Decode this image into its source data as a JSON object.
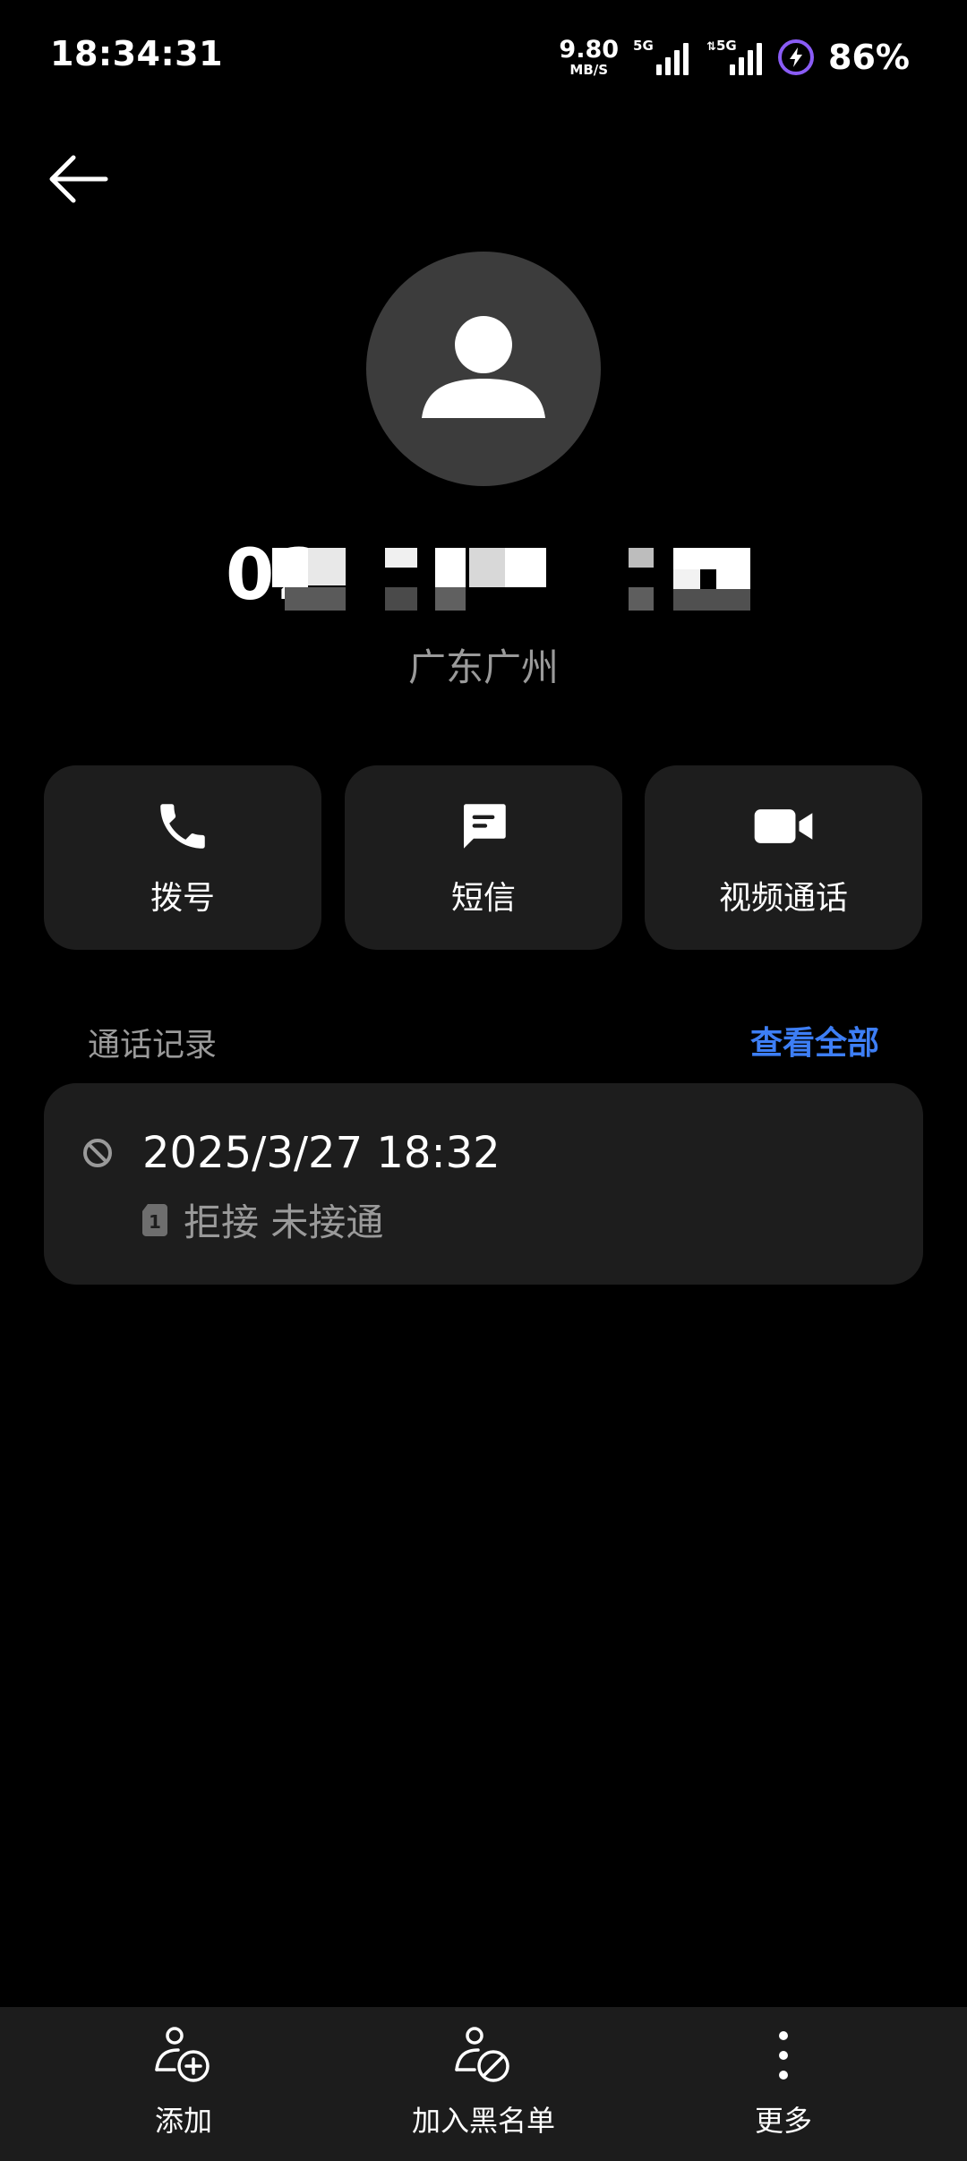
{
  "status_bar": {
    "time": "18:34:31",
    "net_speed_value": "9.80",
    "net_speed_unit": "MB/S",
    "sim1_tag": "5G",
    "sim2_tag": "5G",
    "battery_percent": "86%",
    "battery_icon": "charging-bolt-icon"
  },
  "header": {
    "back_icon": "arrow-left-icon"
  },
  "contact": {
    "avatar_icon": "person-icon",
    "number_visible_prefix": "02",
    "location": "广东广州"
  },
  "actions": [
    {
      "label": "拨号",
      "icon": "phone-icon"
    },
    {
      "label": "短信",
      "icon": "message-icon"
    },
    {
      "label": "视频通话",
      "icon": "video-icon"
    }
  ],
  "call_log": {
    "title": "通话记录",
    "view_all": "查看全部",
    "entries": [
      {
        "datetime": "2025/3/27 18:32",
        "sim_slot": "1",
        "status": "拒接 未接通",
        "icon": "blocked-icon"
      }
    ]
  },
  "bottom_bar": {
    "items": [
      {
        "label": "添加",
        "icon": "add-contact-icon"
      },
      {
        "label": "加入黑名单",
        "icon": "block-contact-icon"
      },
      {
        "label": "更多",
        "icon": "more-vertical-icon"
      }
    ]
  },
  "colors": {
    "background": "#000000",
    "card": "#1d1d1d",
    "accent": "#3d7ef5",
    "secondary_text": "#9a9a9a",
    "battery_ring": "#8a5cf6"
  }
}
